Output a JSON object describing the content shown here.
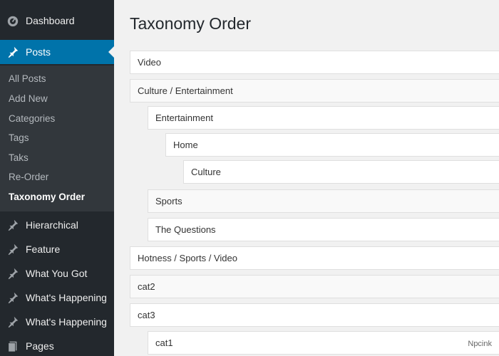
{
  "sidebar": {
    "dashboard": "Dashboard",
    "posts": "Posts",
    "submenu": [
      "All Posts",
      "Add New",
      "Categories",
      "Tags",
      "Taks",
      "Re-Order",
      "Taxonomy Order"
    ],
    "items": [
      "Hierarchical",
      "Feature",
      "What You Got",
      "What's Happening",
      "What's Happening",
      "Pages"
    ]
  },
  "main": {
    "title": "Taxonomy Order",
    "terms": [
      {
        "label": "Video",
        "level": 0
      },
      {
        "label": "Culture / Entertainment",
        "level": 0
      },
      {
        "label": "Entertainment",
        "level": 1
      },
      {
        "label": "Home",
        "level": 2
      },
      {
        "label": "Culture",
        "level": 3
      },
      {
        "label": "Sports",
        "level": 1
      },
      {
        "label": "The Questions",
        "level": 1
      },
      {
        "label": "Hotness / Sports / Video",
        "level": 0
      },
      {
        "label": "cat2",
        "level": 0
      },
      {
        "label": "cat3",
        "level": 0
      },
      {
        "label": "cat1",
        "level": 1
      }
    ]
  },
  "watermark": "Npcink",
  "colors": {
    "sidebar_bg": "#23282d",
    "submenu_bg": "#32373c",
    "active_bg": "#0073aa",
    "page_bg": "#f1f1f1"
  }
}
